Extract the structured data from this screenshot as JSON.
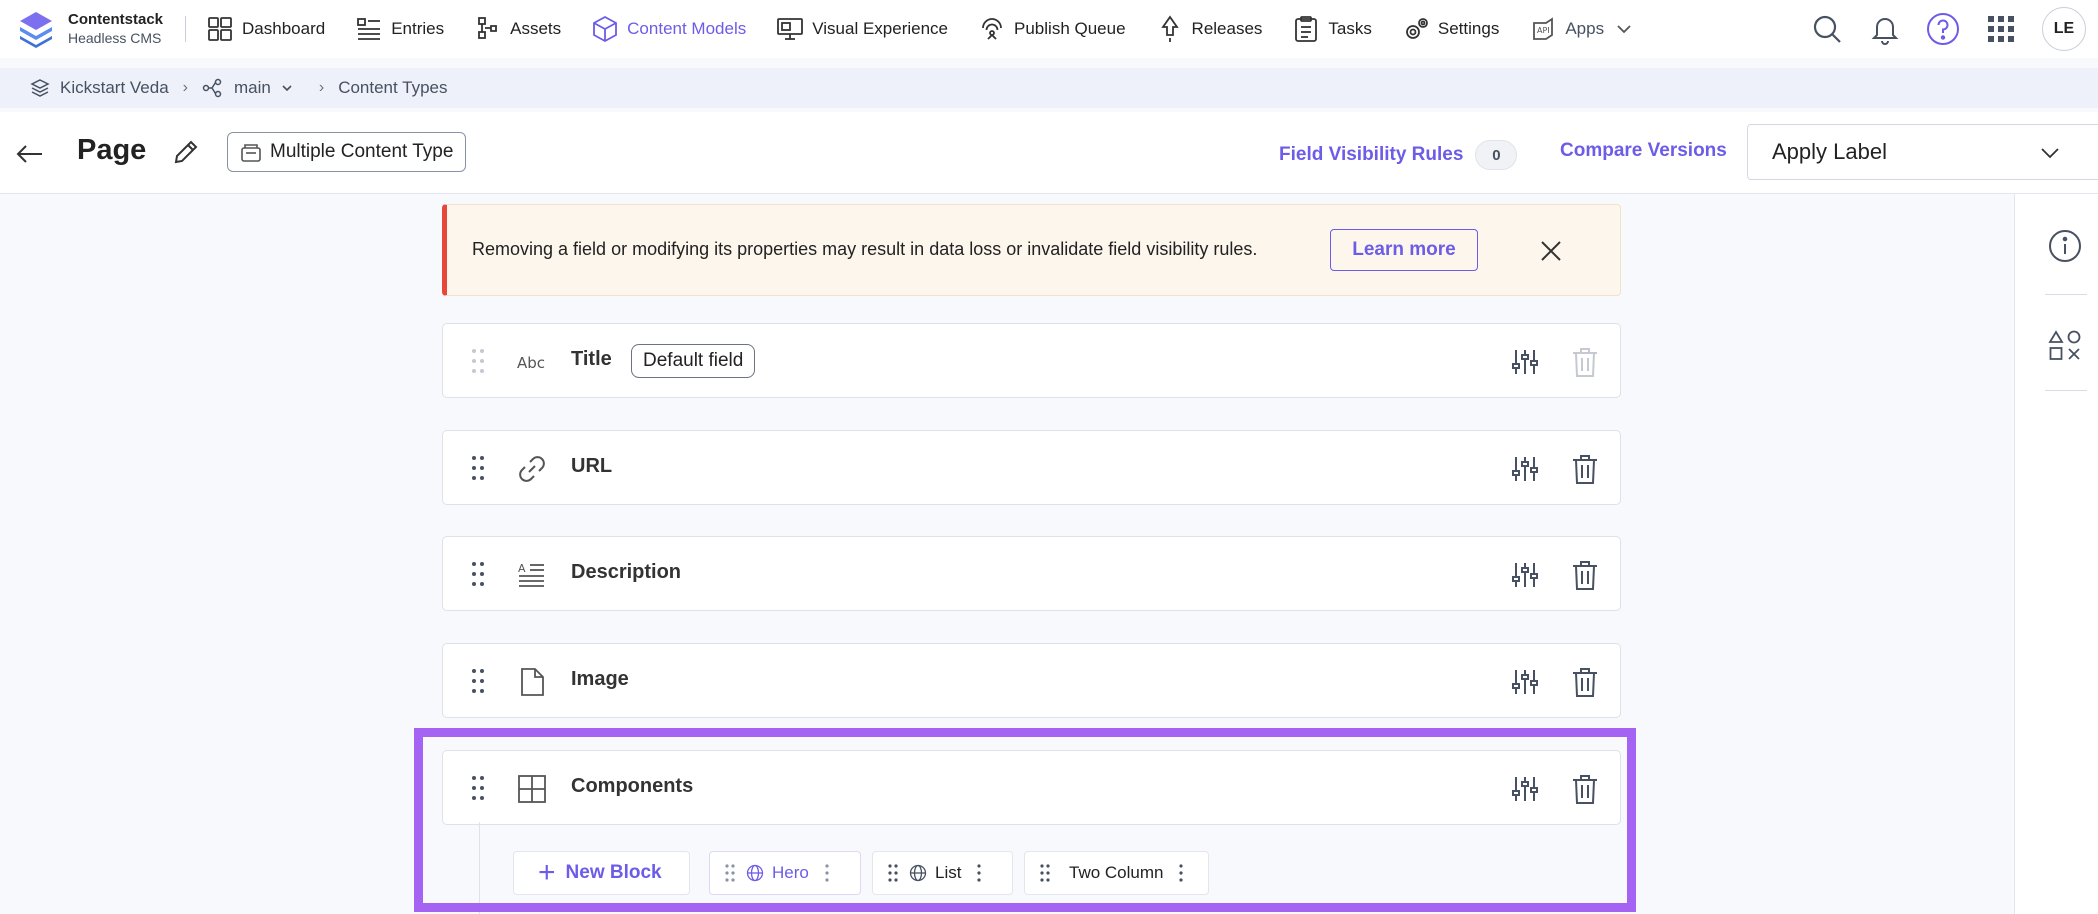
{
  "brand": {
    "name": "Contentstack",
    "subtitle": "Headless CMS",
    "accent": "#6c5ce7"
  },
  "nav": {
    "items": [
      {
        "label": "Dashboard",
        "icon": "dashboard-icon"
      },
      {
        "label": "Entries",
        "icon": "entries-icon"
      },
      {
        "label": "Assets",
        "icon": "assets-icon"
      },
      {
        "label": "Content Models",
        "icon": "content-models-icon",
        "active": true
      },
      {
        "label": "Visual Experience",
        "icon": "visual-experience-icon"
      },
      {
        "label": "Publish Queue",
        "icon": "publish-queue-icon"
      },
      {
        "label": "Releases",
        "icon": "releases-icon"
      },
      {
        "label": "Tasks",
        "icon": "tasks-icon"
      },
      {
        "label": "Settings",
        "icon": "settings-icon"
      },
      {
        "label": "Apps",
        "icon": "apps-icon"
      }
    ],
    "user_initials": "LE"
  },
  "breadcrumb": {
    "stack": "Kickstart Veda",
    "branch": "main",
    "section": "Content Types"
  },
  "header": {
    "title": "Page",
    "content_type_badge": "Multiple Content Type",
    "field_visibility_label": "Field Visibility Rules",
    "field_visibility_count": "0",
    "compare_versions": "Compare Versions",
    "apply_label": "Apply Label"
  },
  "alert": {
    "message": "Removing a field or modifying its properties may result in data loss or invalidate field visibility rules.",
    "learn_more": "Learn more"
  },
  "fields": [
    {
      "name": "Title",
      "type_icon": "text-icon",
      "badge": "Default field"
    },
    {
      "name": "URL",
      "type_icon": "link-icon"
    },
    {
      "name": "Description",
      "type_icon": "multiline-text-icon"
    },
    {
      "name": "Image",
      "type_icon": "file-icon"
    },
    {
      "name": "Components",
      "type_icon": "modular-blocks-icon"
    }
  ],
  "blocks": {
    "new_block": "New Block",
    "items": [
      {
        "label": "Hero",
        "active": true
      },
      {
        "label": "List"
      },
      {
        "label": "Two Column"
      }
    ]
  }
}
